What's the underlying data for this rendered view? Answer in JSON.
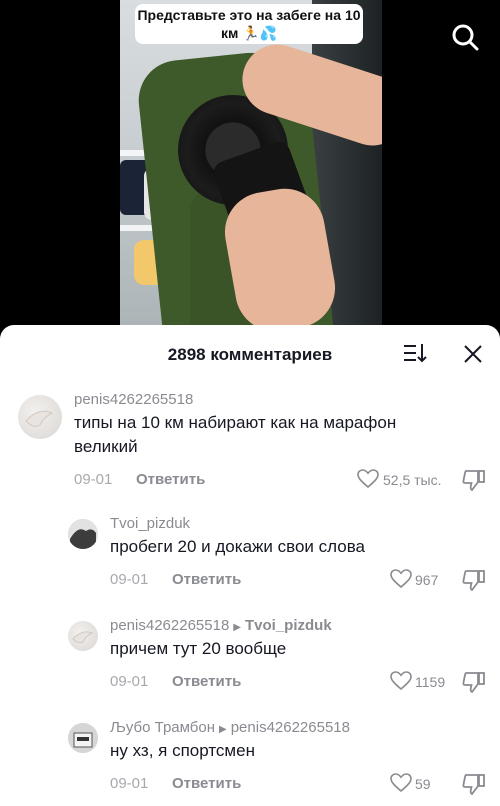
{
  "video": {
    "caption": "Представьте это на забеге на 10 км 🏃💦"
  },
  "comments_sheet": {
    "title": "2898 комментариев",
    "comments": [
      {
        "username": "penis4262265518",
        "reply_to": "",
        "text": "типы на 10 км набирают как на марафон великий",
        "date": "09-01",
        "reply_label": "Ответить",
        "likes": "52,5 тыс."
      },
      {
        "username": "Tvoi_pizduk",
        "reply_to": "",
        "text": "пробеги 20 и докажи свои слова",
        "date": "09-01",
        "reply_label": "Ответить",
        "likes": "967"
      },
      {
        "username": "penis4262265518",
        "reply_to": "Tvoi_pizduk",
        "text": "причем тут 20 вообще",
        "date": "09-01",
        "reply_label": "Ответить",
        "likes": "1159"
      },
      {
        "username": "Љубо Трамбон",
        "reply_to": "penis4262265518",
        "text": "ну хз, я спортсмен",
        "date": "09-01",
        "reply_label": "Ответить",
        "likes": "59"
      }
    ]
  }
}
